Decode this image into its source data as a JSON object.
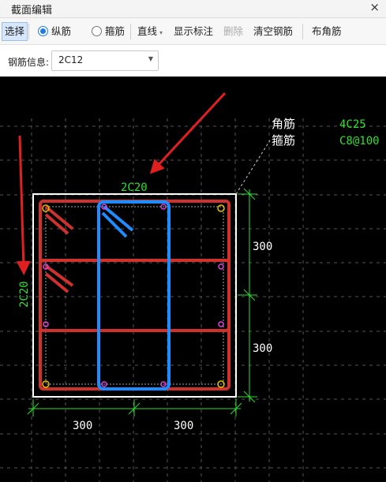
{
  "window": {
    "title": "截面编辑",
    "close_symbol": "×"
  },
  "toolbar": {
    "select": "选择",
    "longitudinal": "纵筋",
    "stirrup": "箍筋",
    "line": "直线",
    "show_annotation": "显示标注",
    "delete": "删除",
    "clear_rebar": "清空钢筋",
    "place_corner": "布角筋",
    "selected_radio": "纵筋"
  },
  "rebar_info": {
    "label": "钢筋信息:",
    "value": "2C12"
  },
  "canvas": {
    "top_rebar_label": "2C20",
    "left_rebar_label": "2C20",
    "corner_label": "角筋",
    "corner_value": "4C25",
    "stirrup_label": "箍筋",
    "stirrup_value": "C8@100",
    "dim_right_upper": "300",
    "dim_right_lower": "300",
    "dim_bottom_left": "300",
    "dim_bottom_right": "300",
    "colors": {
      "column_outline": "#ffffff",
      "rebar_red": "#d0312d",
      "stirrup_blue": "#1f8cff",
      "dimension_green": "#2ee02e",
      "arrow_red": "#e02020",
      "point_magenta": "#e040e0",
      "corner_yellow": "#e0c000"
    }
  }
}
